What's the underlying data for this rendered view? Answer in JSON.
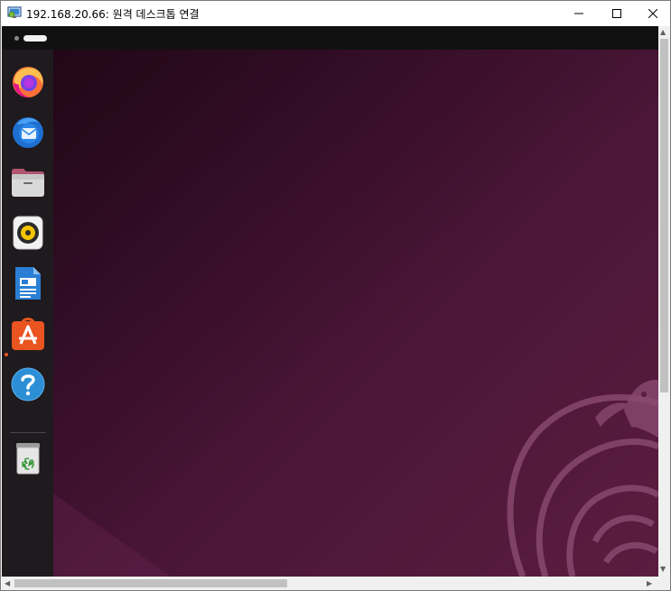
{
  "window": {
    "title": "192.168.20.66: 원격 데스크톱 연결",
    "app_icon": "remote-desktop-icon",
    "controls": {
      "minimize": "minimize-icon",
      "maximize": "maximize-icon",
      "close": "close-icon"
    }
  },
  "topbar": {
    "workspace_indicator": "activities-workspace-indicator"
  },
  "dock": {
    "items": [
      {
        "name": "Firefox",
        "icon": "firefox-icon"
      },
      {
        "name": "Thunderbird",
        "icon": "thunderbird-icon"
      },
      {
        "name": "Files",
        "icon": "files-icon"
      },
      {
        "name": "Rhythmbox",
        "icon": "rhythmbox-icon"
      },
      {
        "name": "LibreOffice Writer",
        "icon": "writer-icon"
      },
      {
        "name": "Ubuntu Software",
        "icon": "software-icon",
        "running": true
      },
      {
        "name": "Help",
        "icon": "help-icon"
      },
      {
        "name": "Trash",
        "icon": "trash-icon"
      }
    ]
  },
  "colors": {
    "dock_bg": "#1f1a1e",
    "topbar_bg": "#111111",
    "desktop_dark": "#2c0a1f",
    "desktop_light": "#5a1d40",
    "ubuntu_orange": "#e95420"
  }
}
